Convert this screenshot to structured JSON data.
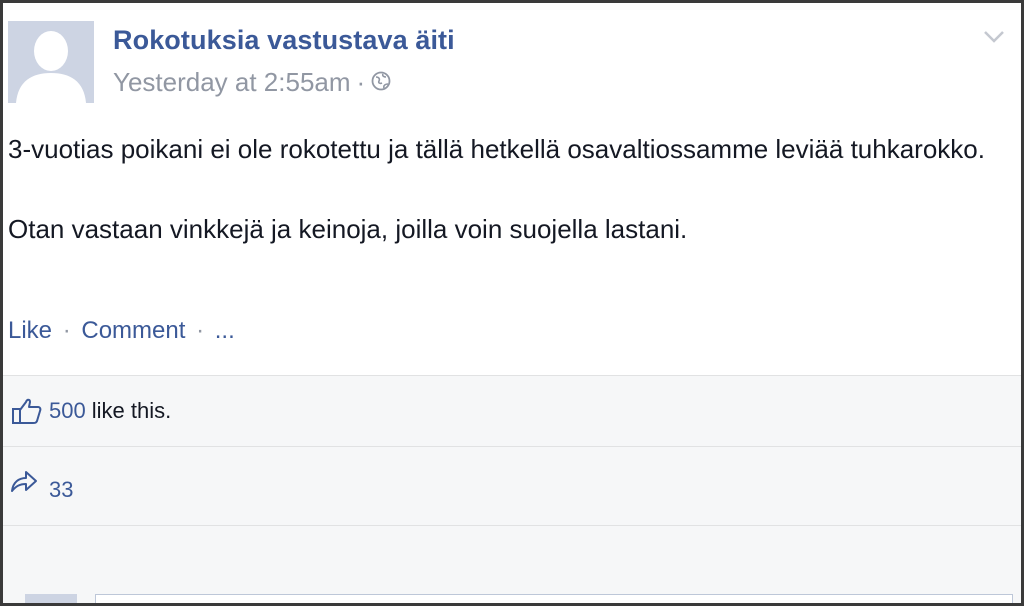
{
  "post": {
    "author": "Rokotuksia vastustava äiti",
    "timestamp": "Yesterday at 2:55am",
    "separator": "·",
    "audience_icon": "globe-icon",
    "menu_icon": "chevron-down-icon",
    "paragraphs": [
      "3-vuotias poikani ei ole rokotettu ja tällä hetkellä osavaltiossamme leviää tuhkarokko.",
      "Otan vastaan vinkkejä ja keinoja, joilla voin suojella lastani."
    ],
    "actions": {
      "like": "Like",
      "comment": "Comment",
      "more": "...",
      "separator": "·"
    }
  },
  "ufi": {
    "likes": {
      "icon": "thumbs-up-icon",
      "count": "500",
      "suffix": "like this."
    },
    "shares": {
      "icon": "share-arrow-icon",
      "count": "33"
    }
  },
  "colors": {
    "link": "#3b5998",
    "meta": "#9197a3",
    "text": "#141823",
    "ufi_bg": "#f6f7f8",
    "avatar_placeholder": "#cdd4e3"
  }
}
